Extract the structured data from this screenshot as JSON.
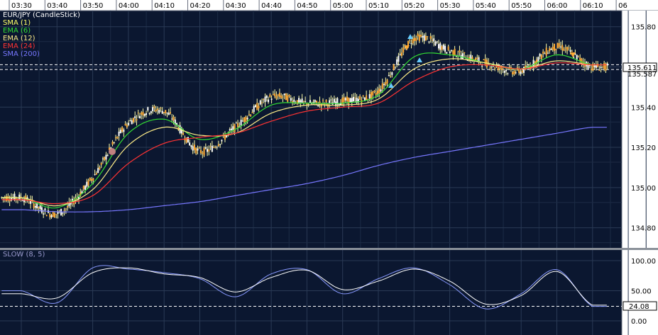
{
  "time_axis": {
    "labels": [
      "03:30",
      "03:40",
      "03:50",
      "04:00",
      "04:10",
      "04:20",
      "04:30",
      "04:40",
      "04:50",
      "05:00",
      "05:10",
      "05:20",
      "05:30",
      "05:40",
      "05:50",
      "06:00",
      "06:10",
      "06"
    ]
  },
  "price_panel": {
    "legend": [
      {
        "text": "EUR/JPY (CandleStick)",
        "color": "#ffffff"
      },
      {
        "text": "SMA (1)",
        "color": "#ffff66"
      },
      {
        "text": "EMA (6)",
        "color": "#33dd33"
      },
      {
        "text": "EMA (12)",
        "color": "#ffee88"
      },
      {
        "text": "EMA (24)",
        "color": "#ff3333"
      },
      {
        "text": "SMA (200)",
        "color": "#7777ff"
      }
    ],
    "y_ticks": [
      "135.80",
      "135.60",
      "135.40",
      "135.20",
      "135.00",
      "134.80"
    ],
    "y_tick_values": [
      135.8,
      135.6,
      135.4,
      135.2,
      135.0,
      134.8
    ],
    "current_price_label": "135.611",
    "secondary_price_label": "135.587",
    "current_price": 135.611,
    "secondary_price": 135.587
  },
  "oscillator_panel": {
    "title": "SLOW (8, 5)",
    "y_ticks": [
      "100.00",
      "50.00",
      "0.00"
    ],
    "y_tick_values": [
      100,
      50,
      0
    ],
    "current_value_label": "24.08",
    "current_value": 24.08
  },
  "colors": {
    "background": "#0b1730",
    "grid": "#2a3a55",
    "axis_bg": "#ffffff",
    "candle": "#ffffaa",
    "sma1": "#ffff66",
    "ema6": "#33dd33",
    "ema12": "#ffee88",
    "ema24": "#ff3333",
    "sma200": "#7777ff",
    "osc1": "#8899ff",
    "osc2": "#ffffff"
  },
  "chart_data": [
    {
      "type": "line",
      "title": "EUR/JPY (CandleStick)",
      "x": [
        "03:30",
        "03:40",
        "03:50",
        "04:00",
        "04:10",
        "04:20",
        "04:30",
        "04:40",
        "04:50",
        "05:00",
        "05:10",
        "05:20",
        "05:30",
        "05:40",
        "05:50",
        "06:00",
        "06:10"
      ],
      "ylim": [
        134.7,
        135.88
      ],
      "series": [
        {
          "name": "SMA (1)",
          "values": [
            134.95,
            134.87,
            135.05,
            135.32,
            135.38,
            135.18,
            135.3,
            135.45,
            135.42,
            135.43,
            135.48,
            135.74,
            135.68,
            135.62,
            135.58,
            135.7,
            135.6
          ]
        },
        {
          "name": "EMA (6)",
          "values": [
            134.95,
            134.9,
            135.02,
            135.27,
            135.34,
            135.24,
            135.29,
            135.41,
            135.42,
            135.42,
            135.46,
            135.65,
            135.66,
            135.62,
            135.59,
            135.66,
            135.61
          ]
        },
        {
          "name": "EMA (12)",
          "values": [
            134.95,
            134.91,
            134.99,
            135.21,
            135.3,
            135.26,
            135.27,
            135.37,
            135.41,
            135.41,
            135.44,
            135.59,
            135.64,
            135.62,
            135.59,
            135.63,
            135.61
          ]
        },
        {
          "name": "EMA (24)",
          "values": [
            134.94,
            134.92,
            134.96,
            135.12,
            135.22,
            135.25,
            135.27,
            135.33,
            135.38,
            135.4,
            135.42,
            135.53,
            135.6,
            135.61,
            135.59,
            135.62,
            135.61
          ]
        },
        {
          "name": "SMA (200)",
          "values": [
            134.89,
            134.88,
            134.88,
            134.89,
            134.91,
            134.93,
            134.96,
            134.99,
            135.02,
            135.06,
            135.11,
            135.15,
            135.18,
            135.21,
            135.24,
            135.27,
            135.3
          ]
        }
      ]
    },
    {
      "type": "line",
      "title": "SLOW (8, 5)",
      "x": [
        "03:30",
        "03:40",
        "03:50",
        "04:00",
        "04:10",
        "04:20",
        "04:30",
        "04:40",
        "04:50",
        "05:00",
        "05:10",
        "05:20",
        "05:30",
        "05:40",
        "05:50",
        "06:00",
        "06:10"
      ],
      "ylim": [
        0,
        100
      ],
      "series": [
        {
          "values": [
            50,
            30,
            88,
            86,
            80,
            70,
            40,
            78,
            85,
            45,
            70,
            88,
            60,
            20,
            45,
            85,
            24
          ]
        },
        {
          "values": [
            45,
            38,
            80,
            88,
            78,
            72,
            48,
            72,
            84,
            52,
            66,
            86,
            66,
            28,
            42,
            82,
            26
          ]
        }
      ]
    }
  ]
}
